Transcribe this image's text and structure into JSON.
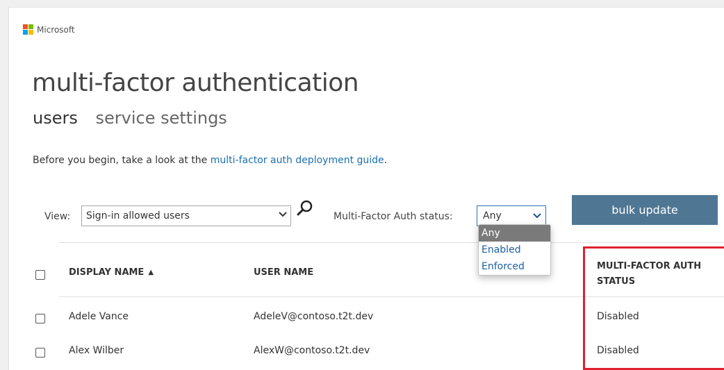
{
  "brand": {
    "name": "Microsoft",
    "logo_colors": [
      "#f25022",
      "#7fba00",
      "#00a4ef",
      "#ffb900"
    ]
  },
  "page": {
    "title": "multi-factor authentication"
  },
  "subnav": {
    "users": "users",
    "service_settings": "service settings"
  },
  "intro": {
    "text": "Before you begin, take a look at the ",
    "link": "multi-factor auth deployment guide",
    "end": "."
  },
  "filters": {
    "view_label": "View:",
    "view_value": "Sign-in allowed users",
    "mfa_label": "Multi-Factor Auth status:",
    "mfa_value": "Any",
    "mfa_options": [
      "Any",
      "Enabled",
      "Enforced"
    ]
  },
  "bulk_update_label": "bulk update",
  "table": {
    "headers": {
      "display_name": "DISPLAY NAME",
      "user_name": "USER NAME",
      "mfa_status_1": "MULTI-FACTOR AUTH",
      "mfa_status_2": "STATUS"
    },
    "sort_indicator": "▲",
    "rows": [
      {
        "display_name": "Adele Vance",
        "user_name": "AdeleV@contoso.t2t.dev",
        "status": "Disabled"
      },
      {
        "display_name": "Alex Wilber",
        "user_name": "AlexW@contoso.t2t.dev",
        "status": "Disabled"
      }
    ]
  },
  "colors": {
    "accent": "#4f7794",
    "link": "#1a6fb2",
    "highlight": "#e0202e"
  }
}
